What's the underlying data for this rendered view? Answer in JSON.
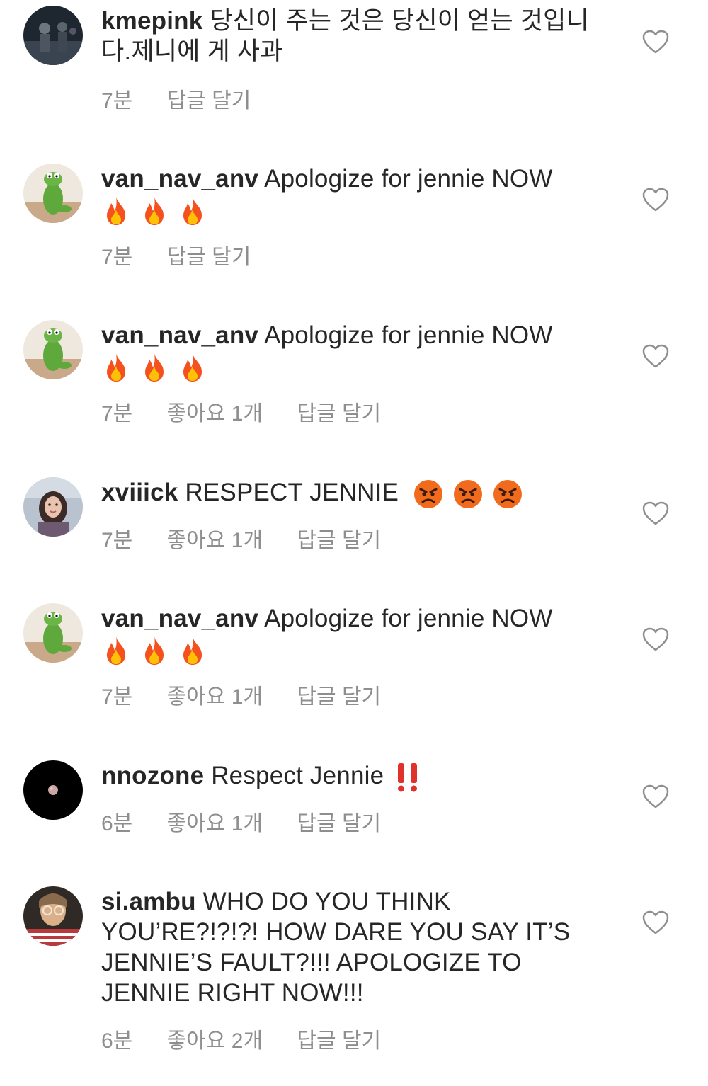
{
  "comments": [
    {
      "username": "kmepink",
      "text": "당신이 주는 것은 당신이 얻는 것입니다.제니에 게 사과",
      "time": "7분",
      "likes": "",
      "reply": "답글 달기",
      "emojis": []
    },
    {
      "username": "van_nav_anv",
      "text": "Apologize for jennie NOW",
      "time": "7분",
      "likes": "",
      "reply": "답글 달기",
      "emojis": [
        "fire",
        "fire",
        "fire"
      ]
    },
    {
      "username": "van_nav_anv",
      "text": "Apologize for jennie NOW",
      "time": "7분",
      "likes": "좋아요 1개",
      "reply": "답글 달기",
      "emojis": [
        "fire",
        "fire",
        "fire"
      ]
    },
    {
      "username": "xviiick",
      "text": "RESPECT JENNIE",
      "time": "7분",
      "likes": "좋아요 1개",
      "reply": "답글 달기",
      "emojis": [
        "angry-face",
        "angry-face",
        "angry-face"
      ]
    },
    {
      "username": "van_nav_anv",
      "text": "Apologize for jennie NOW",
      "time": "7분",
      "likes": "좋아요 1개",
      "reply": "답글 달기",
      "emojis": [
        "fire",
        "fire",
        "fire"
      ]
    },
    {
      "username": "nnozone",
      "text": "Respect Jennie",
      "time": "6분",
      "likes": "좋아요 1개",
      "reply": "답글 달기",
      "emojis": [
        "double-exclamation"
      ]
    },
    {
      "username": "si.ambu",
      "text": "WHO DO YOU THINK YOU’RE?!?!?! HOW DARE YOU SAY IT’S JENNIE’S FAULT?!!! APOLOGIZE TO JENNIE RIGHT NOW!!!",
      "time": "6분",
      "likes": "좋아요 2개",
      "reply": "답글 달기",
      "emojis": []
    }
  ],
  "colors": {
    "text": "#262626",
    "meta": "#8e8e8e",
    "heart": "#8e8e8e"
  },
  "icons": {
    "like": "heart-outline-icon",
    "fire": "fire-emoji",
    "angry": "angry-face-emoji",
    "exclamation": "double-exclamation-emoji"
  }
}
